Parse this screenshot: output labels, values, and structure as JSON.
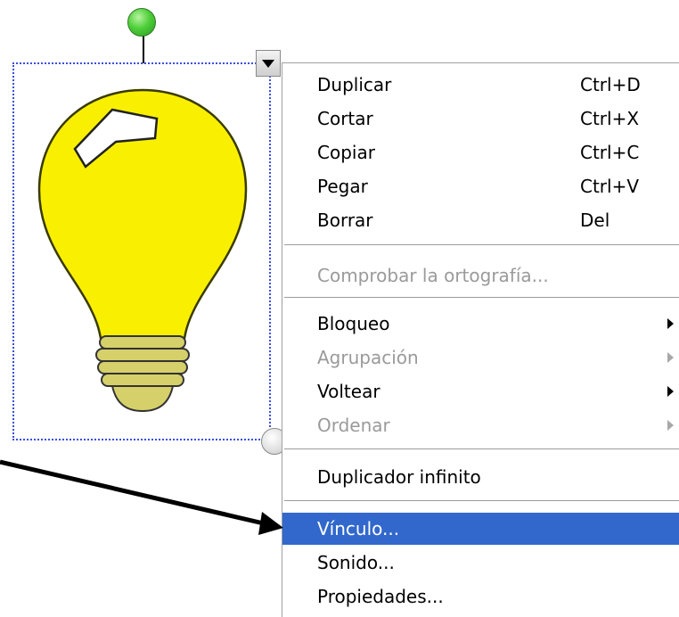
{
  "context_menu": {
    "items": [
      {
        "label": "Duplicar",
        "shortcut": "Ctrl+D"
      },
      {
        "label": "Cortar",
        "shortcut": "Ctrl+X"
      },
      {
        "label": "Copiar",
        "shortcut": "Ctrl+C"
      },
      {
        "label": "Pegar",
        "shortcut": "Ctrl+V"
      },
      {
        "label": "Borrar",
        "shortcut": "Del"
      },
      {
        "label": "Comprobar la ortografía...",
        "disabled": true
      },
      {
        "label": "Bloqueo",
        "submenu": true
      },
      {
        "label": "Agrupación",
        "submenu": true,
        "disabled": true
      },
      {
        "label": "Voltear",
        "submenu": true
      },
      {
        "label": "Ordenar",
        "submenu": true,
        "disabled": true
      },
      {
        "label": "Duplicador infinito"
      },
      {
        "label": "Vínculo...",
        "highlighted": true
      },
      {
        "label": "Sonido..."
      },
      {
        "label": "Propiedades..."
      }
    ]
  },
  "colors": {
    "highlight": "#3268cc",
    "selection_border": "#3c4fe0",
    "bulb_fill": "#f8f000",
    "bulb_base": "#d6d06a",
    "rotate_handle": "#4fcf3a"
  },
  "icons": {
    "object": "light-bulb-icon",
    "rotate": "rotate-handle-icon",
    "menu_arrow": "triangle-down-icon",
    "submenu": "triangle-right-icon"
  }
}
